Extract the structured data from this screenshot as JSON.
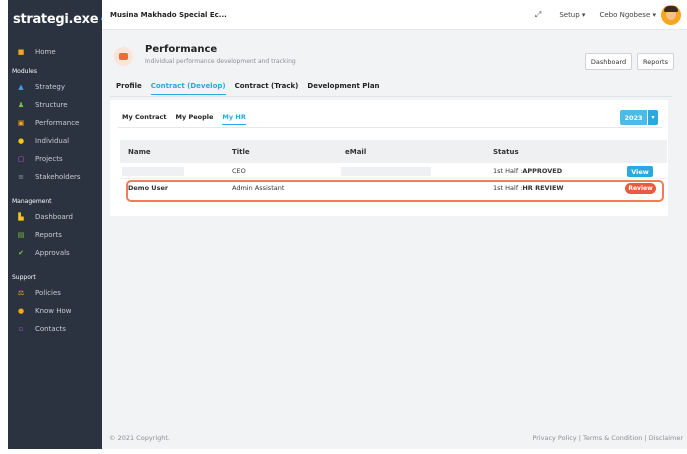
{
  "brand": {
    "logo_text": "strategi.exe",
    "logo_mark_color": "#29a9e0"
  },
  "colors": {
    "sidebar_bg": "#2b3340",
    "accent": "#29a9e0",
    "review": "#ec5a3b"
  },
  "sidebar": {
    "items_top": [
      {
        "label": "Home",
        "icon": "home-icon",
        "icon_color": "#f5a623"
      }
    ],
    "sections": [
      {
        "title": "Modules",
        "items": [
          {
            "label": "Strategy",
            "icon": "strategy-icon",
            "icon_color": "#29a9e0"
          },
          {
            "label": "Structure",
            "icon": "structure-icon",
            "icon_color": "#7ac143"
          },
          {
            "label": "Performance",
            "icon": "performance-icon",
            "icon_color": "#f5a623"
          },
          {
            "label": "Individual",
            "icon": "individual-icon",
            "icon_color": "#f5c518"
          },
          {
            "label": "Projects",
            "icon": "projects-icon",
            "icon_color": "#c35bd8"
          },
          {
            "label": "Stakeholders",
            "icon": "stakeholders-icon",
            "icon_color": "#8a94a6"
          }
        ]
      },
      {
        "title": "Management",
        "items": [
          {
            "label": "Dashboard",
            "icon": "dashboard-icon",
            "icon_color": "#f5c518"
          },
          {
            "label": "Reports",
            "icon": "reports-icon",
            "icon_color": "#7ac143"
          },
          {
            "label": "Approvals",
            "icon": "approvals-icon",
            "icon_color": "#7ac143"
          }
        ]
      },
      {
        "title": "Support",
        "items": [
          {
            "label": "Policies",
            "icon": "policies-icon",
            "icon_color": "#e8a33c"
          },
          {
            "label": "Know How",
            "icon": "know-how-icon",
            "icon_color": "#f5a623"
          },
          {
            "label": "Contacts",
            "icon": "contacts-icon",
            "icon_color": "#a05bd8"
          }
        ]
      }
    ]
  },
  "topbar": {
    "org_name": "Musina Makhado Special Ec...",
    "setup_label": "Setup ▾",
    "user_label": "Cebo Ngobese ▾"
  },
  "header": {
    "title": "Performance",
    "subtitle": "Individual performance development and tracking",
    "dashboard_label": "Dashboard",
    "reports_label": "Reports"
  },
  "tabs": [
    {
      "label": "Profile",
      "active": false
    },
    {
      "label": "Contract (Develop)",
      "active": true
    },
    {
      "label": "Contract (Track)",
      "active": false
    },
    {
      "label": "Development Plan",
      "active": false
    }
  ],
  "subtabs": [
    {
      "label": "My Contract",
      "active": false
    },
    {
      "label": "My People",
      "active": false
    },
    {
      "label": "My HR",
      "active": true
    }
  ],
  "year": {
    "value": "2023",
    "caret": "▾"
  },
  "table": {
    "columns": [
      "Name",
      "Title",
      "eMail",
      "Status"
    ],
    "rows": [
      {
        "name": "",
        "title": "CEO",
        "email": "",
        "status_prefix": "1st Half : ",
        "status_value": "APPROVED",
        "action": "View"
      },
      {
        "name": "Demo User",
        "title": "Admin Assistant",
        "email": "",
        "status_prefix": "1st Half : ",
        "status_value": "HR REVIEW",
        "action": "Review"
      }
    ]
  },
  "footer": {
    "copyright": "© 2021 Copyright.",
    "links": "Privacy Policy | Terms & Condition | Disclaimer"
  }
}
